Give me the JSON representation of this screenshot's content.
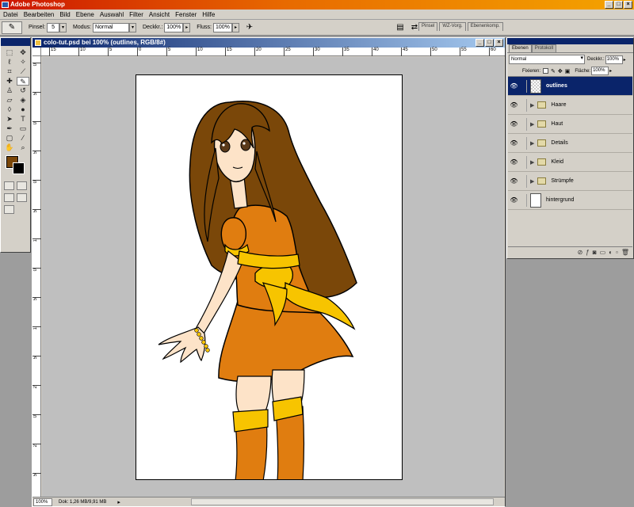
{
  "app": {
    "title": "Adobe Photoshop",
    "window_buttons": [
      "_",
      "□",
      "×"
    ]
  },
  "menu": [
    "Datei",
    "Bearbeiten",
    "Bild",
    "Ebene",
    "Auswahl",
    "Filter",
    "Ansicht",
    "Fenster",
    "Hilfe"
  ],
  "options": {
    "brush_label": "Pinsel:",
    "brush_size": "5",
    "mode_label": "Modus:",
    "mode_value": "Normal",
    "opacity_label": "Deckkr.:",
    "opacity_value": "100%",
    "flow_label": "Fluss:",
    "flow_value": "100%"
  },
  "palette_well": [
    "Pinsel",
    "WZ-Vorg.",
    "Ebenenkomp."
  ],
  "toolbox": {
    "foreground_color": "#7a4709",
    "background_color": "#000000"
  },
  "document": {
    "title": "colo-tut.psd bei 100% (outlines, RGB/8#)",
    "ruler_h": [
      "15",
      "10",
      "5",
      "0",
      "5",
      "10",
      "15",
      "20",
      "25",
      "30",
      "35",
      "40",
      "45",
      "50",
      "55",
      "60"
    ],
    "ruler_v": [
      "0",
      "5",
      "0",
      "5",
      "0",
      "5",
      "1",
      "0",
      "5",
      "1",
      "5",
      "2",
      "0",
      "2",
      "5"
    ],
    "zoom": "100%",
    "doc_info": "Dok: 1,26 MB/9,91 MB"
  },
  "layers": {
    "tabs": [
      "Ebenen",
      "Protokoll"
    ],
    "blend_mode": "Normal",
    "opacity_label": "Deckkr.:",
    "opacity_value": "100%",
    "lock_label": "Fixieren:",
    "fill_label": "Fläche:",
    "fill_value": "100%",
    "items": [
      {
        "name": "outlines",
        "type": "layer",
        "selected": true
      },
      {
        "name": "Haare",
        "type": "group"
      },
      {
        "name": "Haut",
        "type": "group"
      },
      {
        "name": "Details",
        "type": "group"
      },
      {
        "name": "Kleid",
        "type": "group"
      },
      {
        "name": "Strümpfe",
        "type": "group"
      },
      {
        "name": "hintergrund",
        "type": "layer"
      }
    ]
  },
  "colors": {
    "hair": "#7a4709",
    "dress": "#e07d10",
    "sash": "#f7c400",
    "skin": "#fde3c8",
    "title_bar": "#e86a00",
    "selection": "#0a246a"
  }
}
